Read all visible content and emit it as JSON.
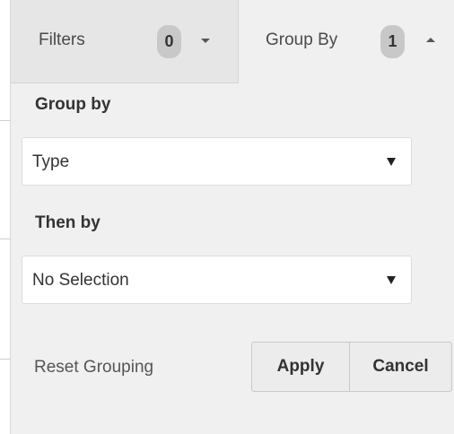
{
  "tabs": {
    "filters": {
      "label": "Filters",
      "count": "0",
      "caret": "chevron-down-icon"
    },
    "group_by": {
      "label": "Group By",
      "count": "1",
      "caret": "chevron-up-icon"
    }
  },
  "panel": {
    "group_by_label": "Group by",
    "group_by_value": "Type",
    "then_by_label": "Then by",
    "then_by_value": "No Selection",
    "reset_label": "Reset Grouping",
    "apply_label": "Apply",
    "cancel_label": "Cancel"
  },
  "colors": {
    "panel_bg": "#f0f0f0",
    "inactive_tab_bg": "#e6e6e6",
    "badge_bg": "#c8c8c8",
    "button_bg": "#ececec"
  }
}
